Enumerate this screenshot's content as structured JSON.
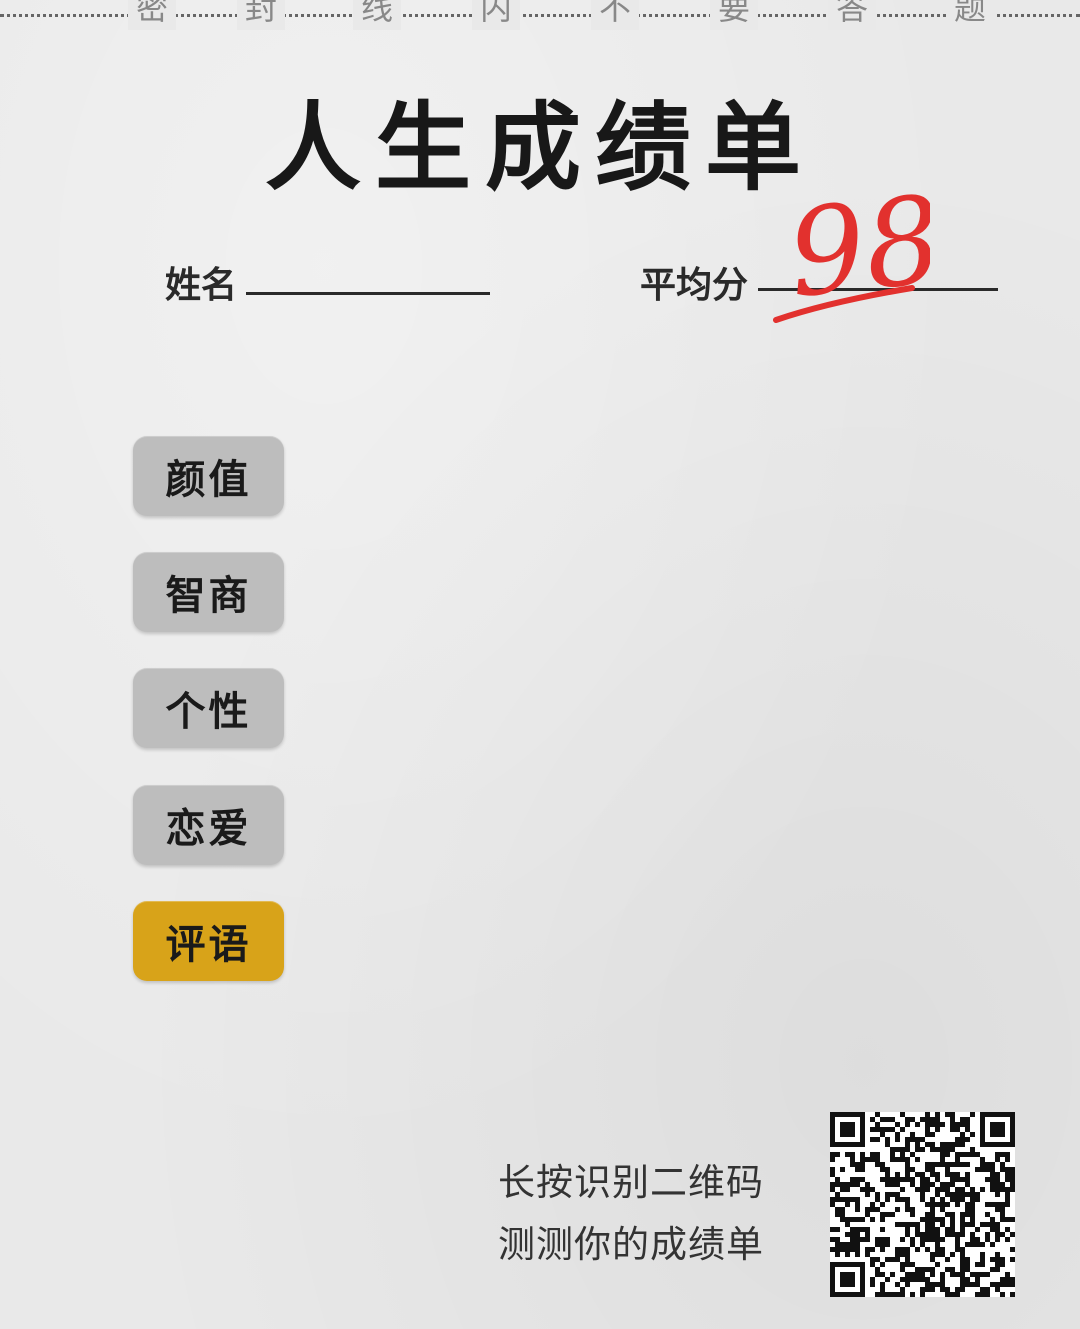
{
  "seal_line": {
    "chars": [
      "密",
      "封",
      "线",
      "内",
      "不",
      "要",
      "答",
      "题"
    ]
  },
  "title": "人生成绩单",
  "fields": {
    "name_label": "姓名",
    "average_label": "平均分",
    "score": "98"
  },
  "menu": {
    "items": [
      {
        "label": "颜值",
        "active": false
      },
      {
        "label": "智商",
        "active": false
      },
      {
        "label": "个性",
        "active": false
      },
      {
        "label": "恋爱",
        "active": false
      },
      {
        "label": "评语",
        "active": true
      }
    ]
  },
  "cta": {
    "line1": "长按识别二维码",
    "line2": "测测你的成绩单"
  },
  "colors": {
    "background": "#e9e9e9",
    "button": "#bdbdbd",
    "button_active": "#d8a319",
    "score_red": "#e2312e"
  },
  "icons": {
    "qr": "qr-code-icon"
  }
}
